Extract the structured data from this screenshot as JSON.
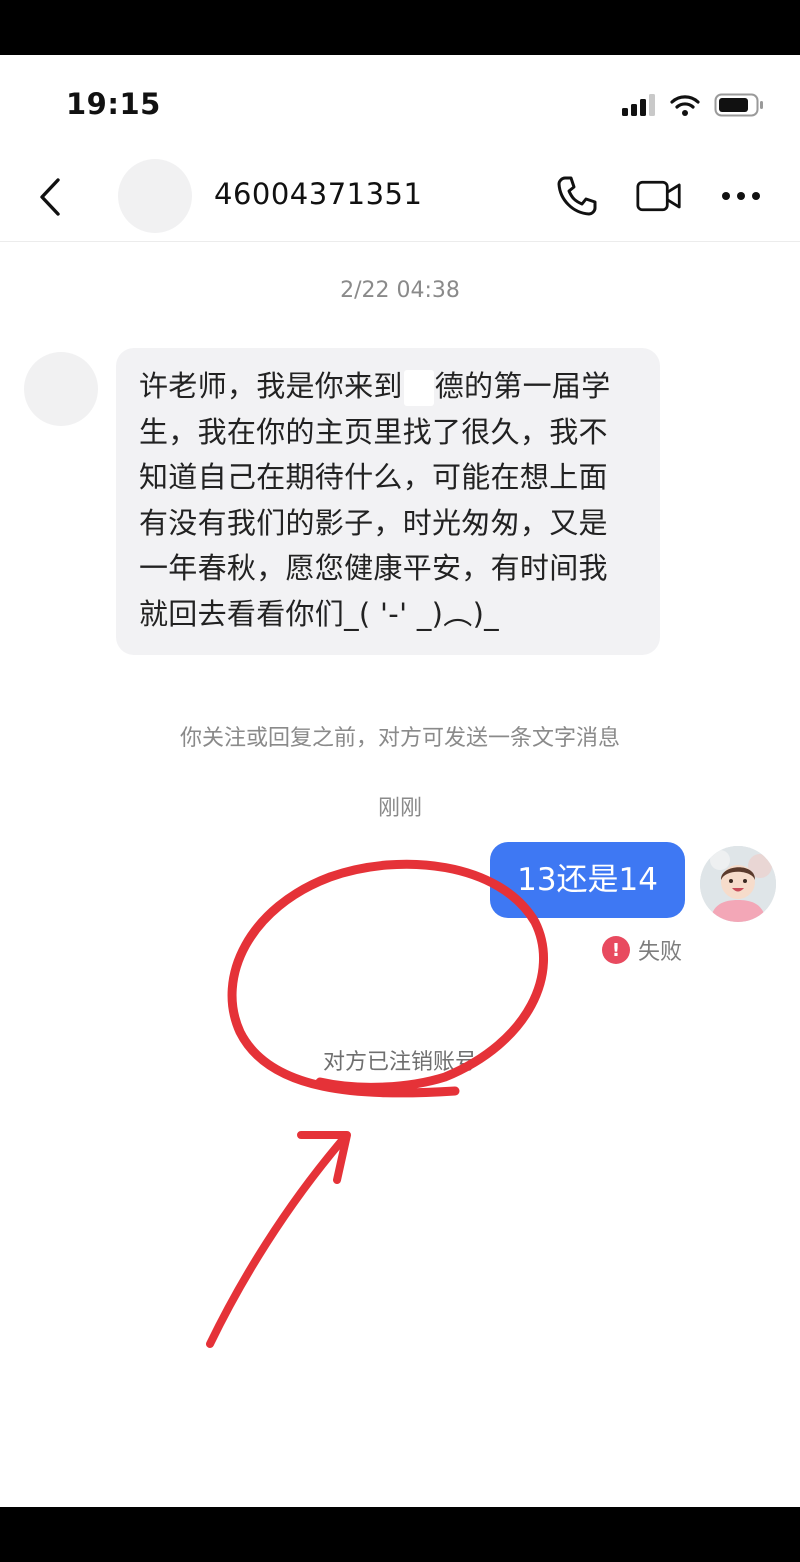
{
  "status_bar": {
    "time": "19:15",
    "icons": [
      "signal-icon",
      "wifi-icon",
      "battery-icon"
    ]
  },
  "header": {
    "back_icon": "chevron-left-icon",
    "contact_name": "46004371351",
    "actions": [
      "phone-icon",
      "video-call-icon",
      "more-icon"
    ]
  },
  "chat": {
    "timestamp_1": "2/22 04:38",
    "incoming_message": {
      "text_before_redaction": "许老师，我是你来到",
      "text_after_redaction": "德的第一届学生，我在你的主页里找了很久，我不知道自己在期待什么，可能在想上面有没有我们的影子，时光匆匆，又是一年春秋，愿您健康平安，有时间我就回去看看你们_( '-' _)︵)_"
    },
    "notice": "你关注或回复之前，对方可发送一条文字消息",
    "timestamp_2": "刚刚",
    "outgoing_message": {
      "text": "13还是14",
      "status": "失败",
      "status_icon": "!"
    },
    "system_notice": "对方已注销账号"
  },
  "colors": {
    "outgoing_bubble": "#3e78f3",
    "incoming_bubble": "#f2f2f4",
    "fail_red": "#e84a5f",
    "annotation_red": "#e53238"
  }
}
